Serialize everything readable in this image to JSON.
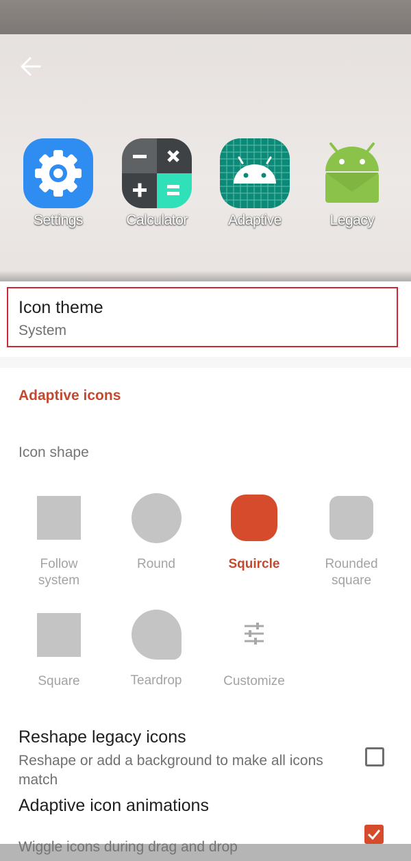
{
  "preview": {
    "apps": [
      {
        "label": "Settings",
        "icon": "settings-gear-icon"
      },
      {
        "label": "Calculator",
        "icon": "calculator-icon"
      },
      {
        "label": "Adaptive",
        "icon": "android-adaptive-icon"
      },
      {
        "label": "Legacy",
        "icon": "android-legacy-icon"
      }
    ]
  },
  "icon_theme": {
    "title": "Icon theme",
    "value": "System"
  },
  "adaptive_section": {
    "header": "Adaptive icons"
  },
  "icon_shape": {
    "header": "Icon shape",
    "selected": "Squircle",
    "options": [
      {
        "line1": "Follow",
        "line2": "system"
      },
      {
        "line1": "Round",
        "line2": ""
      },
      {
        "line1": "Squircle",
        "line2": ""
      },
      {
        "line1": "Rounded",
        "line2": "square"
      },
      {
        "line1": "Square",
        "line2": ""
      },
      {
        "line1": "Teardrop",
        "line2": ""
      },
      {
        "line1": "Customize",
        "line2": "",
        "icon": "sliders-icon"
      }
    ]
  },
  "reshape_legacy": {
    "title": "Reshape legacy icons",
    "summary": "Reshape or add a background to make all icons match",
    "checked": false
  },
  "adaptive_animations": {
    "title": "Adaptive icon animations",
    "summary": "Wiggle icons during drag and drop",
    "checked": true
  },
  "colors": {
    "accent": "#c44a2f",
    "checkbox_on": "#d64b2c",
    "highlight": "#d0262f"
  }
}
